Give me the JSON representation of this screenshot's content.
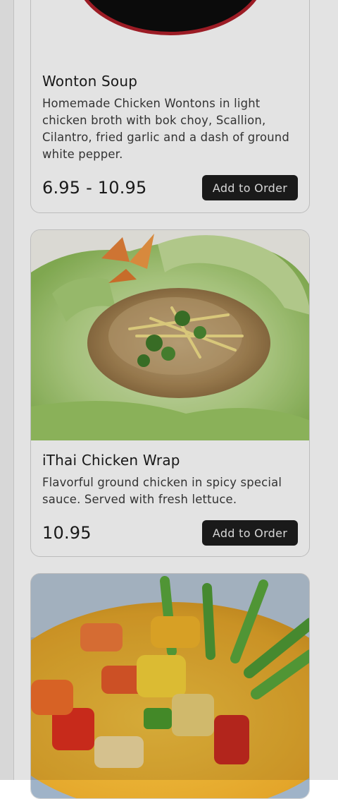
{
  "menu": {
    "items": [
      {
        "title": "Wonton Soup",
        "description": "Homemade Chicken Wontons in light chicken broth with bok choy, Scallion, Cilantro, fried garlic and a dash of ground white pepper.",
        "price": "6.95 - 10.95",
        "button_label": "Add to Order"
      },
      {
        "title": "iThai Chicken Wrap",
        "description": "Flavorful ground chicken in spicy special sauce. Served with fresh lettuce.",
        "price": "10.95",
        "button_label": "Add to Order"
      }
    ]
  },
  "colors": {
    "button_bg": "#1e1e1e",
    "card_border": "#d4d4d4",
    "logo_ring": "#b0202a"
  }
}
